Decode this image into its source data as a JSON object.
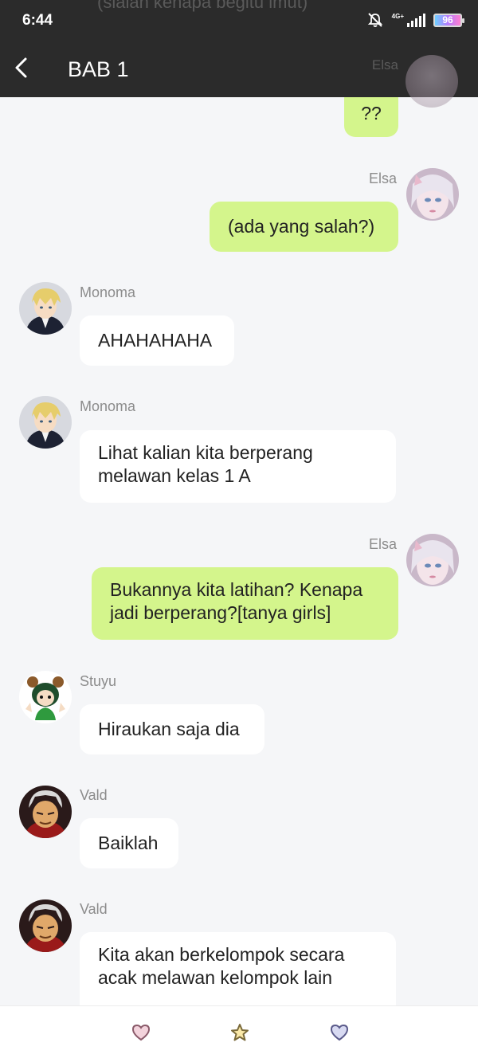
{
  "status_bar": {
    "time": "6:44",
    "network": "4G+",
    "battery": "96",
    "ghost_text": "(siaian kenapa begitu imut)"
  },
  "header": {
    "title": "BAB 1",
    "ghost_name": "Elsa"
  },
  "messages": [
    {
      "sender": "",
      "side": "out",
      "text": "??"
    },
    {
      "sender": "Elsa",
      "side": "out",
      "text": "(ada yang salah?)"
    },
    {
      "sender": "Monoma",
      "side": "in",
      "text": "AHAHAHAHA"
    },
    {
      "sender": "Monoma",
      "side": "in",
      "line1": "Lihat kalian kita berperang",
      "line2": "melawan kelas 1 A"
    },
    {
      "sender": "Elsa",
      "side": "out",
      "line1": "Bukannya kita latihan? Kenapa",
      "line2": "jadi berperang?[tanya girls]"
    },
    {
      "sender": "Stuyu",
      "side": "in",
      "text": "Hiraukan saja dia"
    },
    {
      "sender": "Vald",
      "side": "in",
      "text": "Baiklah"
    },
    {
      "sender": "Vald",
      "side": "in",
      "line1": "Kita akan berkelompok secara",
      "line2": "acak melawan kelompok lain"
    }
  ],
  "bottom_bar": {
    "icons": [
      "heart-icon",
      "star-icon",
      "heart-icon"
    ]
  },
  "colors": {
    "header_bg": "#2b2b2b",
    "outgoing_bubble": "#d4f58c",
    "incoming_bubble": "#ffffff",
    "chat_bg": "#f5f6f8"
  }
}
